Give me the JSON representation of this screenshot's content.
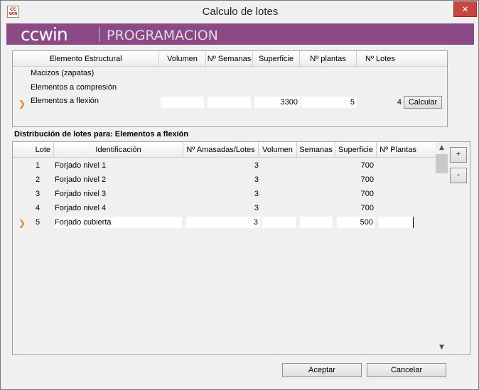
{
  "window": {
    "title": "Calculo de lotes",
    "close": "✕",
    "icon_top": "CC",
    "icon_bottom": "WIN"
  },
  "banner": {
    "logo": "ccwin",
    "subtitle": "PROGRAMACION"
  },
  "grid1": {
    "headers": [
      "Elemento Estructural",
      "Volumen",
      "Nº Semanas",
      "Superficie",
      "Nº plantas",
      "Nº Lotes"
    ],
    "rows": [
      {
        "name": "Macizos (zapatas)"
      },
      {
        "name": "Elementos a compresión"
      },
      {
        "name": "Elementos a flexión",
        "volumen": "",
        "semanas": "",
        "superficie": "3300",
        "plantas": "5",
        "lotes": "4",
        "selected": true
      }
    ],
    "calc_button": "Calcular"
  },
  "section_title": "Distribución de lotes para: Elementos a flexión",
  "grid2": {
    "headers": [
      "Lote",
      "Identificación",
      "Nº Amasadas/Lotes",
      "Volumen",
      "Semanas",
      "Superficie",
      "Nº Plantas"
    ],
    "rows": [
      {
        "lote": "1",
        "id": "Forjado nivel 1",
        "amasadas": "3",
        "volumen": "",
        "semanas": "",
        "superficie": "700",
        "plantas": ""
      },
      {
        "lote": "2",
        "id": "Forjado nivel 2",
        "amasadas": "3",
        "volumen": "",
        "semanas": "",
        "superficie": "700",
        "plantas": ""
      },
      {
        "lote": "3",
        "id": "Forjado nivel 3",
        "amasadas": "3",
        "volumen": "",
        "semanas": "",
        "superficie": "700",
        "plantas": ""
      },
      {
        "lote": "4",
        "id": "Forjado nivel 4",
        "amasadas": "3",
        "volumen": "",
        "semanas": "",
        "superficie": "700",
        "plantas": ""
      },
      {
        "lote": "5",
        "id": "Forjado cubierta",
        "amasadas": "3",
        "volumen": "",
        "semanas": "",
        "superficie": "500",
        "plantas": "",
        "selected": true
      }
    ]
  },
  "side": {
    "plus": "+",
    "minus": "-"
  },
  "footer": {
    "ok": "Aceptar",
    "cancel": "Cancelar"
  },
  "colors": {
    "banner": "#8a4a86",
    "arrow": "#e8821c",
    "close": "#c7463b"
  },
  "icons": {
    "row_pointer": "chevron-right-icon",
    "scroll_up": "chevron-up-icon",
    "scroll_down": "chevron-down-icon"
  }
}
